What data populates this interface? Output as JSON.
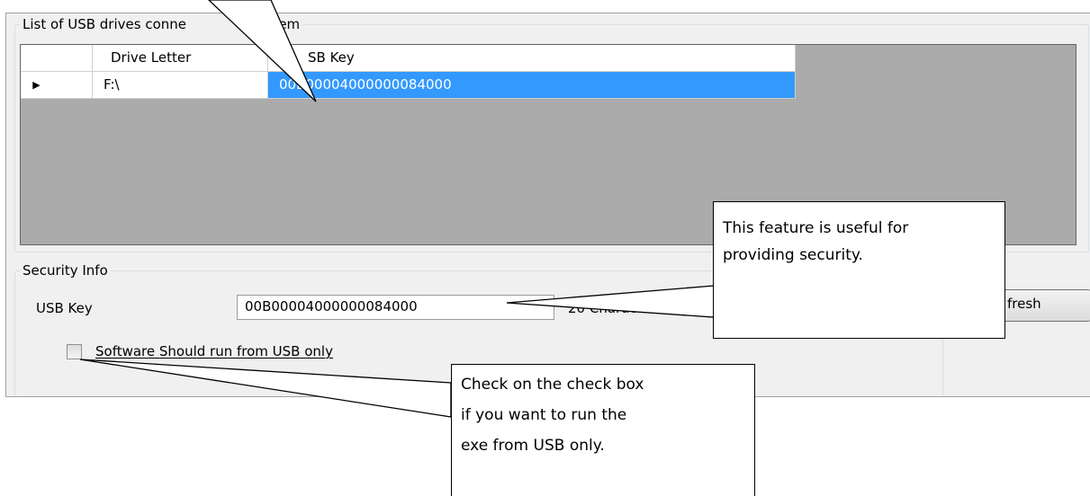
{
  "drives_group": {
    "title_visible": "List of USB drives conne",
    "title_tail": "o system"
  },
  "grid": {
    "columns": [
      "",
      "Drive Letter",
      "USB Key"
    ],
    "header_visible": "SB Key",
    "rows": [
      {
        "indicator": "▶",
        "drive_letter": "F:\\",
        "usb_key": "00B00004000000084000"
      }
    ]
  },
  "security_group": {
    "title": "Security Info",
    "usb_key_label": "USB Key",
    "usb_key_value": "00B00004000000084000",
    "char_hint": "20 Character",
    "checkbox_label": "Software Should run from USB only",
    "checkbox_checked": false,
    "refresh_button_visible": "fresh"
  },
  "callouts": {
    "security_note": [
      "This feature is useful for",
      "providing security."
    ],
    "checkbox_note": [
      "Check on the check box",
      "if you want to run the",
      "exe from USB only."
    ]
  },
  "colors": {
    "selection": "#3399ff",
    "grid_background": "#ababab",
    "panel_background": "#f0f0f0"
  }
}
